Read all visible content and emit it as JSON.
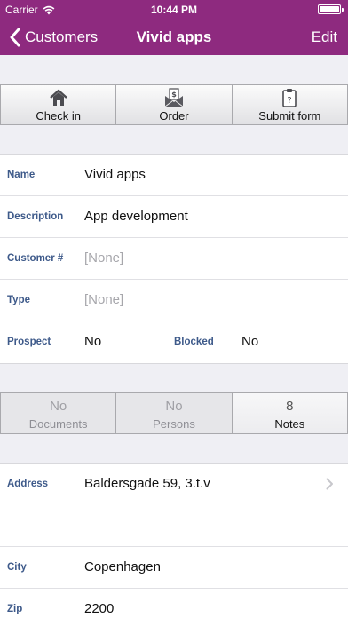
{
  "status_bar": {
    "carrier": "Carrier",
    "time": "10:44 PM",
    "wifi_icon": "wifi-icon",
    "battery_icon": "battery-icon"
  },
  "nav": {
    "back_label": "Customers",
    "title": "Vivid apps",
    "edit_label": "Edit",
    "back_icon": "chevron-left-icon"
  },
  "colors": {
    "brand": "#8e2a7f",
    "field_label": "#3e5a8a",
    "placeholder": "#a7a7ac",
    "background": "#efeff4"
  },
  "toolbar": {
    "check_in": {
      "label": "Check in",
      "icon": "house-icon"
    },
    "order": {
      "label": "Order",
      "icon": "order-envelope-icon"
    },
    "submit_form": {
      "label": "Submit form",
      "icon": "clipboard-icon"
    }
  },
  "details": {
    "name": {
      "label": "Name",
      "value": "Vivid apps"
    },
    "description": {
      "label": "Description",
      "value": "App development"
    },
    "customer_no": {
      "label": "Customer #",
      "value": "[None]"
    },
    "type": {
      "label": "Type",
      "value": "[None]"
    },
    "prospect": {
      "label": "Prospect",
      "value": "No"
    },
    "blocked": {
      "label": "Blocked",
      "value": "No"
    }
  },
  "tabs": {
    "documents": {
      "count": "No",
      "label": "Documents"
    },
    "persons": {
      "count": "No",
      "label": "Persons"
    },
    "notes": {
      "count": "8",
      "label": "Notes"
    }
  },
  "address_section": {
    "address": {
      "label": "Address",
      "value": "Baldersgade 59, 3.t.v"
    },
    "city": {
      "label": "City",
      "value": "Copenhagen"
    },
    "zip": {
      "label": "Zip",
      "value": "2200"
    }
  }
}
